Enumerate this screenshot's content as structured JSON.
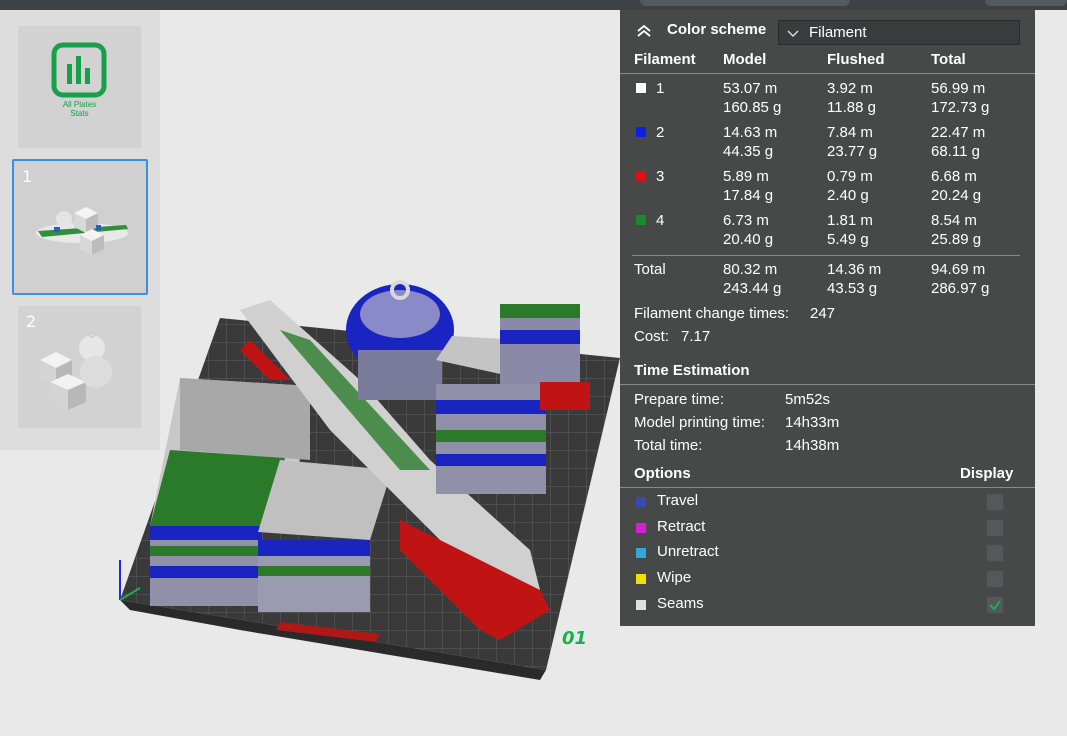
{
  "plates": {
    "all_stats_label_line1": "All Plates",
    "all_stats_label_line2": "Stats",
    "plate1_number": "1",
    "plate2_number": "2"
  },
  "viewport": {
    "plate_badge": "01"
  },
  "stats": {
    "color_scheme_label": "Color scheme",
    "color_scheme_value": "Filament",
    "columns": {
      "filament": "Filament",
      "model": "Model",
      "flushed": "Flushed",
      "total": "Total"
    },
    "filaments": [
      {
        "id": "1",
        "color": "#ffffff",
        "model_len": "53.07 m",
        "model_wt": "160.85 g",
        "flushed_len": "3.92 m",
        "flushed_wt": "11.88 g",
        "total_len": "56.99 m",
        "total_wt": "172.73 g"
      },
      {
        "id": "2",
        "color": "#1020e0",
        "model_len": "14.63 m",
        "model_wt": "44.35 g",
        "flushed_len": "7.84 m",
        "flushed_wt": "23.77 g",
        "total_len": "22.47 m",
        "total_wt": "68.11 g"
      },
      {
        "id": "3",
        "color": "#e01010",
        "model_len": "5.89 m",
        "model_wt": "17.84 g",
        "flushed_len": "0.79 m",
        "flushed_wt": "2.40 g",
        "total_len": "6.68 m",
        "total_wt": "20.24 g"
      },
      {
        "id": "4",
        "color": "#1a8a2a",
        "model_len": "6.73 m",
        "model_wt": "20.40 g",
        "flushed_len": "1.81 m",
        "flushed_wt": "5.49 g",
        "total_len": "8.54 m",
        "total_wt": "25.89 g"
      }
    ],
    "total_row": {
      "label": "Total",
      "model_len": "80.32 m",
      "model_wt": "243.44 g",
      "flushed_len": "14.36 m",
      "flushed_wt": "43.53 g",
      "total_len": "94.69 m",
      "total_wt": "286.97 g"
    },
    "filament_change_label": "Filament change times:",
    "filament_change_value": "247",
    "cost_label": "Cost:",
    "cost_value": "7.17",
    "time_estimation_label": "Time Estimation",
    "prepare_time_label": "Prepare time:",
    "prepare_time_value": "5m52s",
    "model_time_label": "Model printing time:",
    "model_time_value": "14h33m",
    "total_time_label": "Total time:",
    "total_time_value": "14h38m",
    "options_label": "Options",
    "display_label": "Display",
    "options": [
      {
        "label": "Travel",
        "color": "#3a4ab0",
        "checked": false
      },
      {
        "label": "Retract",
        "color": "#d020d0",
        "checked": false
      },
      {
        "label": "Unretract",
        "color": "#30a8d8",
        "checked": false
      },
      {
        "label": "Wipe",
        "color": "#f0e000",
        "checked": false
      },
      {
        "label": "Seams",
        "color": "#e0e0e0",
        "checked": true
      }
    ]
  }
}
